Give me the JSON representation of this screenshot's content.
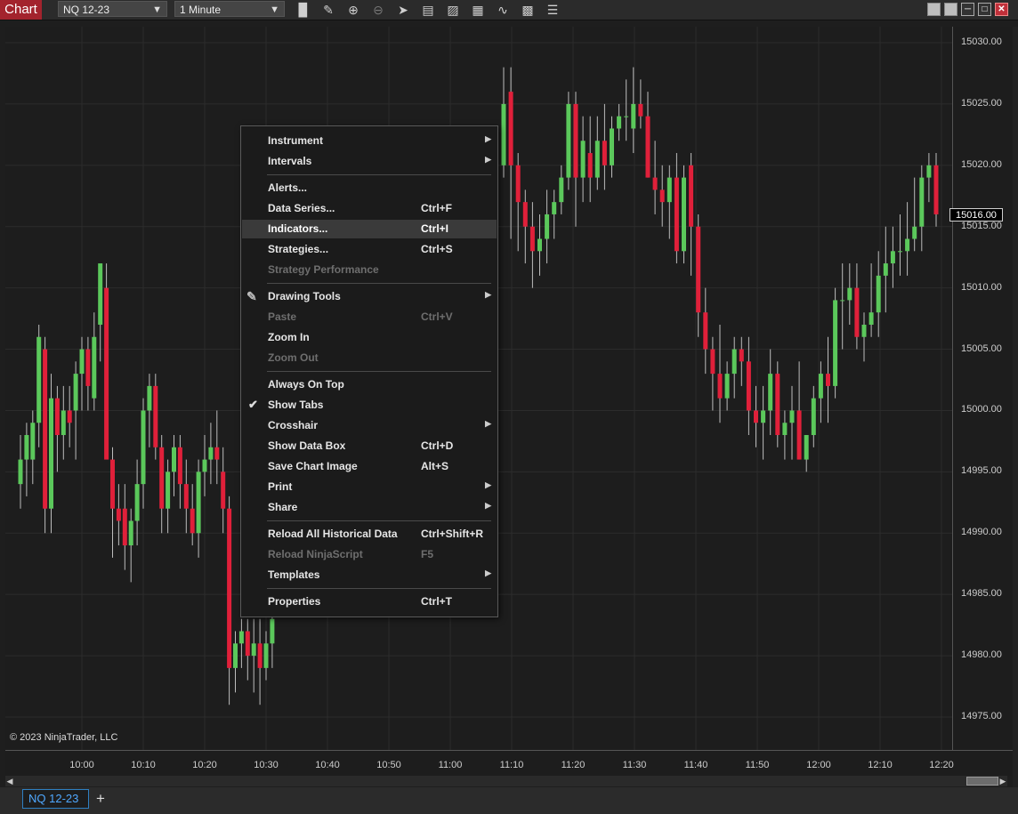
{
  "window": {
    "title": "Chart"
  },
  "toolbar": {
    "instrument": "NQ 12-23",
    "interval": "1 Minute",
    "icons": [
      "bar-type-icon",
      "pencil-icon",
      "zoom-in-icon",
      "zoom-out-icon",
      "pointer-icon",
      "data-box-icon",
      "chart-trader-icon",
      "indicators-icon",
      "strategies-icon",
      "properties-icon",
      "list-icon"
    ]
  },
  "chart": {
    "copyright": "© 2023 NinjaTrader, LLC",
    "last_price": "15016.00",
    "price_ticks": [
      "15030.00",
      "15025.00",
      "15020.00",
      "15015.00",
      "15010.00",
      "15005.00",
      "15000.00",
      "14995.00",
      "14990.00",
      "14985.00",
      "14980.00",
      "14975.00"
    ],
    "price_values": [
      15030,
      15025,
      15020,
      15015,
      15010,
      15005,
      15000,
      14995,
      14990,
      14985,
      14980,
      14975
    ],
    "time_ticks": [
      "10:00",
      "10:10",
      "10:20",
      "10:30",
      "10:40",
      "10:50",
      "11:00",
      "11:10",
      "11:20",
      "11:30",
      "11:40",
      "11:50",
      "12:00",
      "12:10",
      "12:20"
    ],
    "up_color": "#5bc85b",
    "down_color": "#e0203a"
  },
  "context_menu": {
    "items": [
      {
        "label": "Instrument",
        "shortcut": "",
        "submenu": true,
        "disabled": false
      },
      {
        "label": "Intervals",
        "shortcut": "",
        "submenu": true,
        "disabled": false
      },
      {
        "sep": true
      },
      {
        "label": "Alerts...",
        "shortcut": "",
        "disabled": false
      },
      {
        "label": "Data Series...",
        "shortcut": "Ctrl+F",
        "disabled": false
      },
      {
        "label": "Indicators...",
        "shortcut": "Ctrl+I",
        "disabled": false,
        "highlighted": true
      },
      {
        "label": "Strategies...",
        "shortcut": "Ctrl+S",
        "disabled": false
      },
      {
        "label": "Strategy Performance",
        "shortcut": "",
        "disabled": true
      },
      {
        "sep": true
      },
      {
        "label": "Drawing Tools",
        "shortcut": "",
        "submenu": true,
        "disabled": false,
        "icon": "pencil-icon"
      },
      {
        "label": "Paste",
        "shortcut": "Ctrl+V",
        "disabled": true
      },
      {
        "label": "Zoom In",
        "shortcut": "",
        "disabled": false
      },
      {
        "label": "Zoom Out",
        "shortcut": "",
        "disabled": true
      },
      {
        "sep": true
      },
      {
        "label": "Always On Top",
        "shortcut": "",
        "disabled": false
      },
      {
        "label": "Show Tabs",
        "shortcut": "",
        "disabled": false,
        "checked": true
      },
      {
        "label": "Crosshair",
        "shortcut": "",
        "submenu": true,
        "disabled": false
      },
      {
        "label": "Show Data Box",
        "shortcut": "Ctrl+D",
        "disabled": false
      },
      {
        "label": "Save Chart Image",
        "shortcut": "Alt+S",
        "disabled": false
      },
      {
        "label": "Print",
        "shortcut": "",
        "submenu": true,
        "disabled": false
      },
      {
        "label": "Share",
        "shortcut": "",
        "submenu": true,
        "disabled": false
      },
      {
        "sep": true
      },
      {
        "label": "Reload All Historical Data",
        "shortcut": "Ctrl+Shift+R",
        "disabled": false
      },
      {
        "label": "Reload NinjaScript",
        "shortcut": "F5",
        "disabled": true
      },
      {
        "label": "Templates",
        "shortcut": "",
        "submenu": true,
        "disabled": false
      },
      {
        "sep": true
      },
      {
        "label": "Properties",
        "shortcut": "Ctrl+T",
        "disabled": false
      }
    ]
  },
  "tabs": {
    "active": "NQ 12-23",
    "add": "+"
  },
  "chart_data": {
    "type": "candlestick",
    "bars": [
      [
        14994,
        14998,
        14992,
        14996
      ],
      [
        14996,
        14999,
        14993,
        14998
      ],
      [
        14996,
        15000,
        14994,
        14999
      ],
      [
        14999,
        15007,
        14997,
        15006
      ],
      [
        15005,
        15006,
        14990,
        14992
      ],
      [
        14992,
        15003,
        14990,
        15001
      ],
      [
        15001,
        15002,
        14995,
        14998
      ],
      [
        14998,
        15002,
        14996,
        15000
      ],
      [
        15000,
        15002,
        14997,
        14999
      ],
      [
        15000,
        15004,
        14996,
        15003
      ],
      [
        15003,
        15006,
        15000,
        15005
      ],
      [
        15005,
        15006,
        15000,
        15002
      ],
      [
        15001,
        15008,
        15000,
        15006
      ],
      [
        15007,
        15011,
        15004,
        15012
      ],
      [
        15010,
        15012,
        15000,
        14996
      ],
      [
        14996,
        14997,
        14988,
        14992
      ],
      [
        14992,
        14994,
        14989,
        14991
      ],
      [
        14992,
        14994,
        14987,
        14989
      ],
      [
        14989,
        14992,
        14986,
        14991
      ],
      [
        14991,
        14996,
        14989,
        14994
      ],
      [
        14994,
        15001,
        14992,
        15000
      ],
      [
        15000,
        15003,
        14997,
        15002
      ],
      [
        15002,
        15003,
        14996,
        14997
      ],
      [
        14997,
        14998,
        14990,
        14992
      ],
      [
        14992,
        14996,
        14990,
        14995
      ],
      [
        14995,
        14998,
        14993,
        14997
      ],
      [
        14997,
        14998,
        14992,
        14994
      ],
      [
        14994,
        14996,
        14990,
        14992
      ],
      [
        14992,
        14994,
        14989,
        14990
      ],
      [
        14990,
        14996,
        14988,
        14995
      ],
      [
        14995,
        14998,
        14993,
        14996
      ],
      [
        14996,
        14999,
        14994,
        14997
      ],
      [
        14997,
        15000,
        14994,
        14996
      ],
      [
        14995,
        14997,
        14990,
        14992
      ],
      [
        14992,
        14993,
        14976,
        14979
      ],
      [
        14979,
        14982,
        14977,
        14981
      ],
      [
        14981,
        14983,
        14979,
        14982
      ],
      [
        14982,
        14983,
        14978,
        14980
      ],
      [
        14980,
        14983,
        14977,
        14981
      ],
      [
        14981,
        14983,
        14976,
        14979
      ],
      [
        14979,
        14982,
        14978,
        14981
      ],
      [
        14981,
        14984,
        14979,
        14983
      ]
    ]
  }
}
